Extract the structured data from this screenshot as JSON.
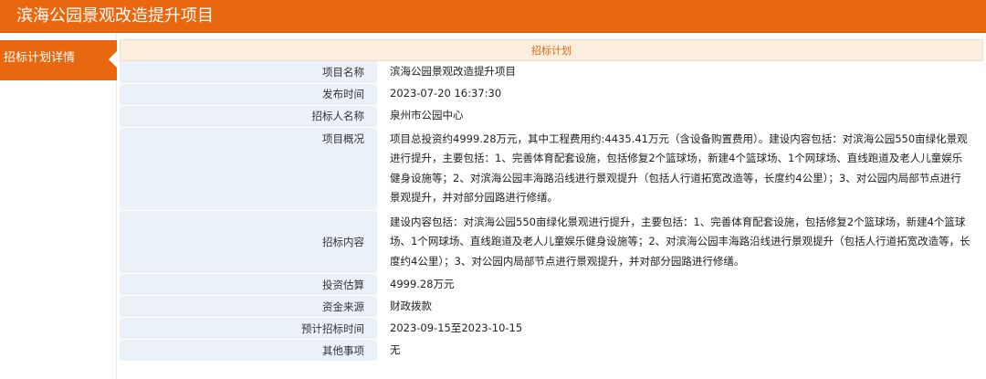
{
  "header": {
    "title": "滨海公园景观改造提升项目"
  },
  "sidebar": {
    "items": [
      {
        "label": "招标计划详情"
      }
    ]
  },
  "section": {
    "title": "招标计划"
  },
  "rows": [
    {
      "label": "项目名称",
      "value": "滨海公园景观改造提升项目"
    },
    {
      "label": "发布时间",
      "value": "2023-07-20 16:37:30"
    },
    {
      "label": "招标人名称",
      "value": "泉州市公园中心"
    },
    {
      "label": "项目概况",
      "value": "项目总投资约4999.28万元，其中工程费用约:4435.41万元（含设备购置费用）。建设内容包括：对滨海公园550亩绿化景观进行提升，主要包括：1、完善体育配套设施，包括修复2个篮球场，新建4个篮球场、1个网球场、直线跑道及老人儿童娱乐健身设施等；2、对滨海公园丰海路沿线进行景观提升（包括人行道拓宽改造等，长度约4公里）；3、对公园内局部节点进行景观提升，并对部分园路进行修缮。"
    },
    {
      "label": "招标内容",
      "value": "建设内容包括：对滨海公园550亩绿化景观进行提升，主要包括：1、完善体育配套设施，包括修复2个篮球场，新建4个篮球场、1个网球场、直线跑道及老人儿童娱乐健身设施等；2、对滨海公园丰海路沿线进行景观提升（包括人行道拓宽改造等，长度约4公里）；3、对公园内局部节点进行景观提升，并对部分园路进行修缮。"
    },
    {
      "label": "投资估算",
      "value": "4999.28万元"
    },
    {
      "label": "资金来源",
      "value": "财政拨款"
    },
    {
      "label": "预计招标时间",
      "value": "2023-09-15至2023-10-15"
    },
    {
      "label": "其他事项",
      "value": "无"
    }
  ]
}
